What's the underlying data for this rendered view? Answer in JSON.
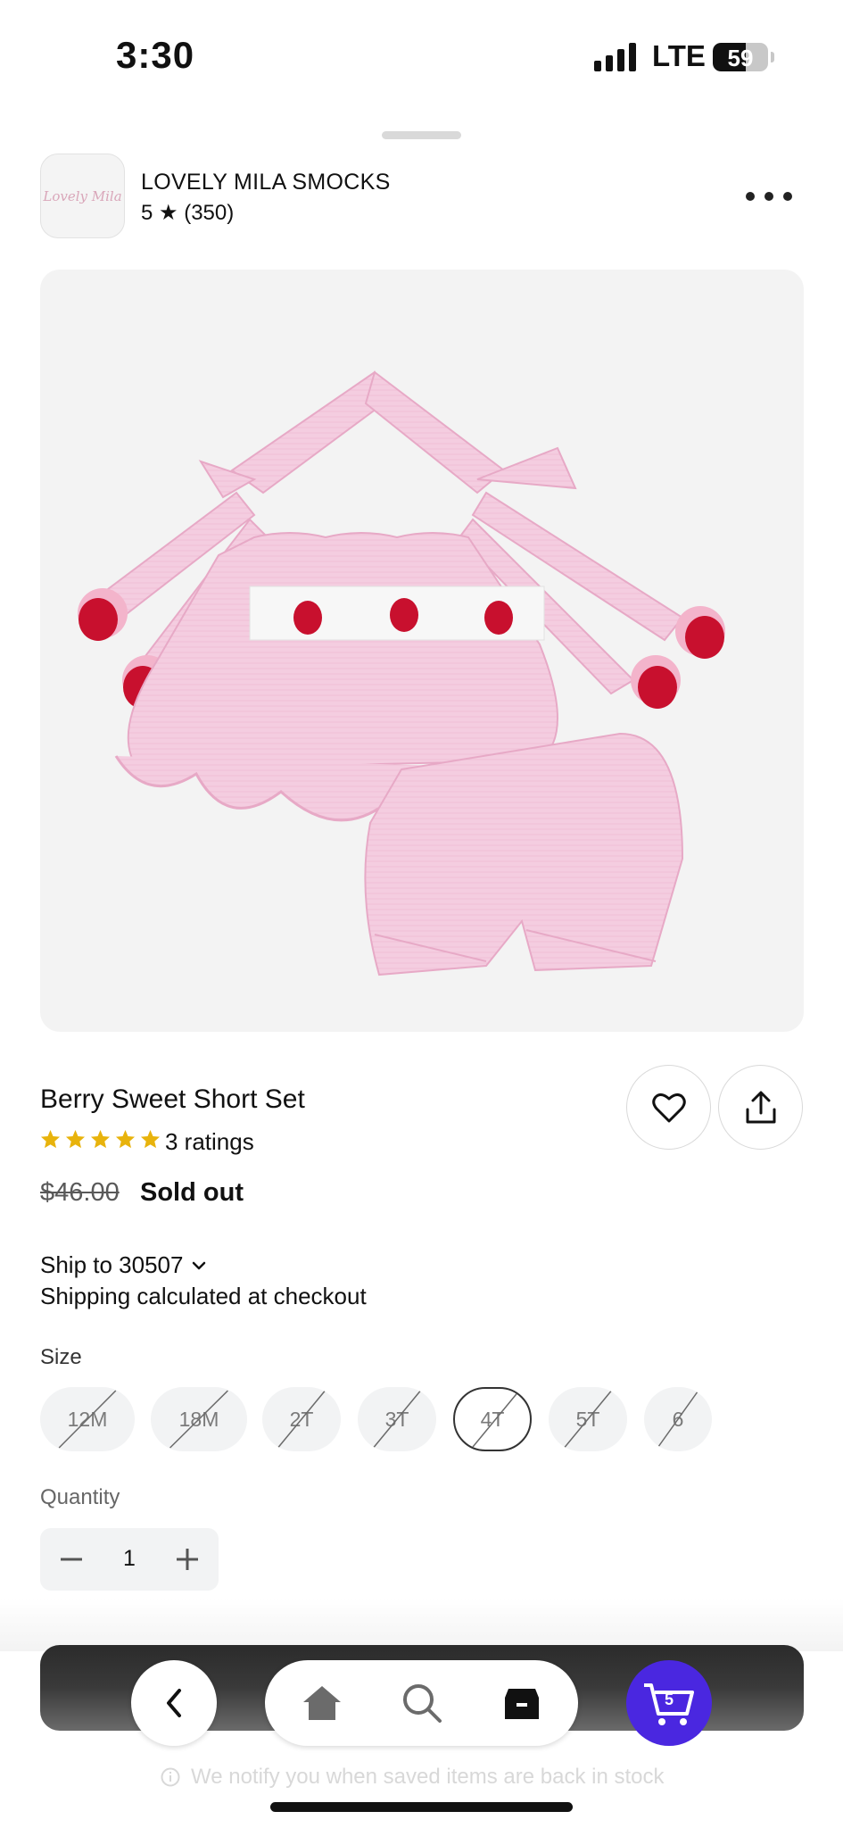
{
  "status_bar": {
    "time": "3:30",
    "network": "LTE",
    "battery_level": "59"
  },
  "shop": {
    "logo_text": "Lovely Mila",
    "name": "LOVELY MILA SMOCKS",
    "rating": "5 ★ (350)"
  },
  "product": {
    "image_icon": "pink-smocked-strawberry-halter-top-and-bloomer-shorts",
    "title": "Berry Sweet Short Set",
    "stars": 5,
    "ratings_text": "3 ratings",
    "old_price": "$46.00",
    "status": "Sold out"
  },
  "shipping": {
    "ship_to": "Ship to 30507",
    "note": "Shipping calculated at checkout"
  },
  "size": {
    "label": "Size",
    "options": [
      "12M",
      "18M",
      "2T",
      "3T",
      "4T",
      "5T",
      "6"
    ],
    "selected": "4T",
    "unavailable": [
      "12M",
      "18M",
      "2T",
      "3T",
      "4T",
      "5T",
      "6"
    ]
  },
  "quantity": {
    "label": "Quantity",
    "value": "1"
  },
  "bottom_nav": {
    "cart_count": "5",
    "notify_text": "We notify you when saved items are back in stock"
  },
  "colors": {
    "accent": "#4a27e0",
    "star": "#e8b30c",
    "product_pink": "#f3c9de"
  }
}
